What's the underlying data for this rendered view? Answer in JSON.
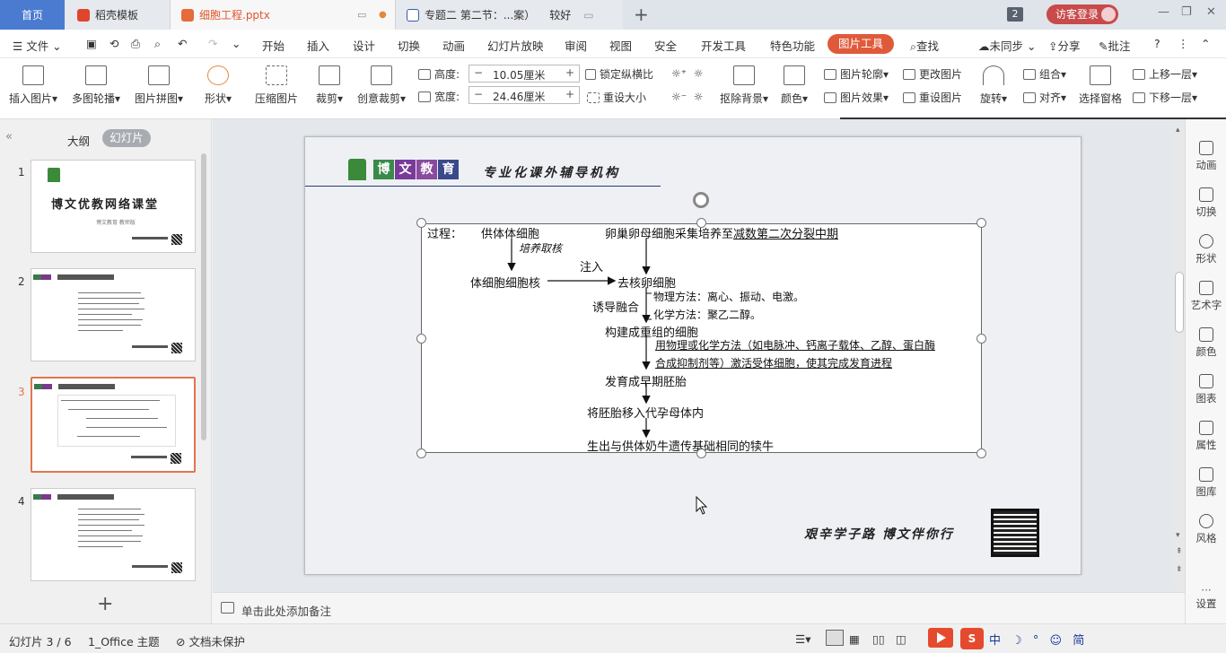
{
  "tabs": {
    "home": "首页",
    "daoke": "稻壳模板",
    "ppt": "细胞工程.pptx",
    "doc": "专题二 第二节：...案）",
    "doc_status": "较好"
  },
  "titlebar": {
    "window_count": "2",
    "visitor_login": "访客登录"
  },
  "menu": {
    "file": "文件",
    "items": [
      "开始",
      "插入",
      "设计",
      "切换",
      "动画",
      "幻灯片放映",
      "审阅",
      "视图",
      "安全",
      "开发工具",
      "特色功能"
    ],
    "picture_tools": "图片工具",
    "search": "查找",
    "sync": "未同步",
    "share": "分享",
    "comment": "批注"
  },
  "ribbon": {
    "insert_picture": "插入图片",
    "multi_outline": "多图轮播",
    "picture_collage": "图片拼图",
    "shape": "形状",
    "compress": "压缩图片",
    "crop": "裁剪",
    "creative_crop": "创意裁剪",
    "height_label": "高度:",
    "height_value": "10.05厘米",
    "width_label": "宽度:",
    "width_value": "24.46厘米",
    "lock_ratio": "锁定纵横比",
    "reset_size": "重设大小",
    "remove_bg": "抠除背景",
    "color": "颜色",
    "picture_outline": "图片轮廓",
    "picture_effect": "图片效果",
    "change_picture": "更改图片",
    "reset_picture": "重设图片",
    "rotate": "旋转",
    "group": "组合",
    "align": "对齐",
    "selection_pane": "选择窗格",
    "bring_forward": "上移一层",
    "send_backward": "下移一层"
  },
  "panel": {
    "outline_tab": "大纲",
    "slides_tab": "幻灯片",
    "slide1_title": "博文优教网络课堂",
    "slide1_sub": "博文教育 教师版"
  },
  "slide": {
    "logo_chars": [
      "博",
      "文",
      "教",
      "育"
    ],
    "org": "专业化课外辅导机构",
    "motto": "艰辛学子路 博文伴你行"
  },
  "flow": {
    "process": "过程：",
    "donor": "供体体细胞",
    "culture": "培养取核",
    "oocyte_pre": "卵巢卵母细胞采集培养至",
    "oocyte_ul": "减数第二次分裂中期",
    "inject": "注入",
    "somatic_nucleus": "体细胞细胞核",
    "enucleated": "去核卵细胞",
    "induce": "诱导融合",
    "physical": "物理方法：离心、振动、电激。",
    "chemical": "化学方法：聚乙二醇。",
    "recombined": "构建成重组的细胞",
    "activate1": "用物理或化学方法（如电脉冲、钙离子载体、乙醇、蛋白酶",
    "activate2": "合成抑制剂等）激活受体细胞，使其完成发育进程",
    "embryo": "发育成早期胚胎",
    "transfer": "将胚胎移入代孕母体内",
    "born": "生出与供体奶牛遗传基础相同的犊牛"
  },
  "notes": "单击此处添加备注",
  "side": [
    "动画",
    "切换",
    "形状",
    "艺术字",
    "颜色",
    "图表",
    "属性",
    "图库",
    "风格",
    "设置"
  ],
  "status": {
    "slide_pos": "幻灯片 3 / 6",
    "theme": "1_Office 主题",
    "protect": "文档未保护",
    "ime": "中 ☽ ° ☺ 简"
  }
}
